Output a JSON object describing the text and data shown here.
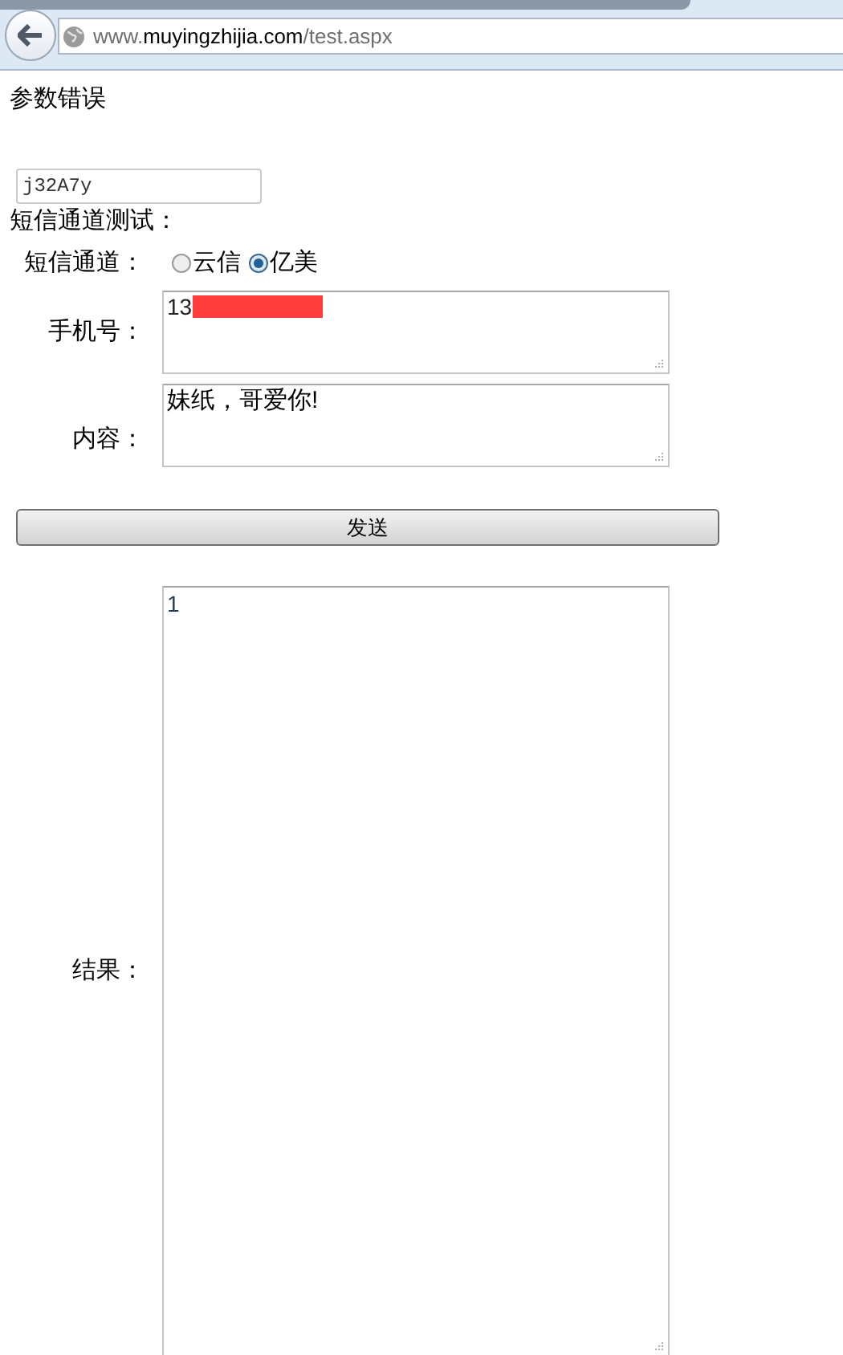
{
  "browser": {
    "url": "www.**muyingzhijia.com**/test.aspx"
  },
  "error_message": "参数错误",
  "code_field": {
    "value": "j32A7y"
  },
  "section_title": "短信通道测试：",
  "channel": {
    "label": "短信通道：",
    "options": [
      {
        "label": "云信",
        "selected": false
      },
      {
        "label": "亿美",
        "selected": true
      }
    ]
  },
  "phone": {
    "label": "手机号：",
    "value": "13"
  },
  "content": {
    "label": "内容：",
    "value": "妹纸，哥爱你!"
  },
  "send_button": "发送",
  "result": {
    "label": "结果：",
    "value": "1"
  }
}
